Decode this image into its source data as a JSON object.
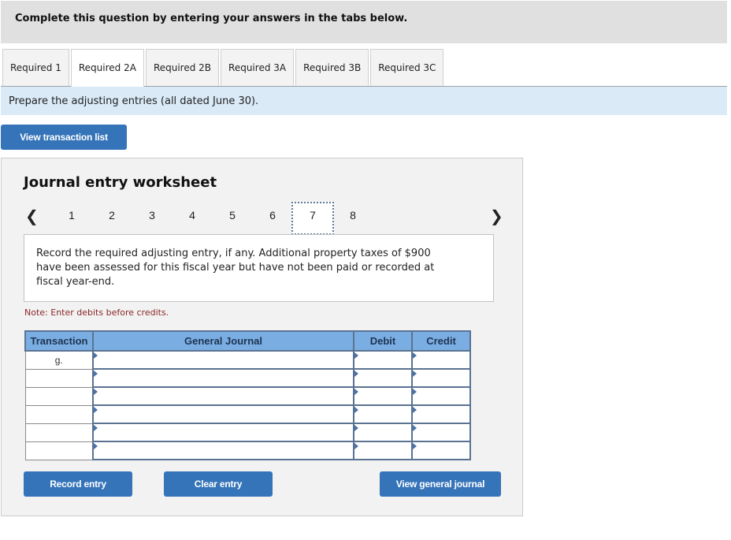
{
  "header": {
    "text": "Complete this question by entering your answers in the tabs below."
  },
  "tabs": [
    {
      "label": "Required 1",
      "active": false
    },
    {
      "label": "Required 2A",
      "active": true
    },
    {
      "label": "Required 2B",
      "active": false
    },
    {
      "label": "Required 3A",
      "active": false
    },
    {
      "label": "Required 3B",
      "active": false
    },
    {
      "label": "Required 3C",
      "active": false
    }
  ],
  "instruction": "Prepare the adjusting entries (all dated June 30).",
  "buttons": {
    "view_transaction_list": "View transaction list",
    "record_entry": "Record entry",
    "clear_entry": "Clear entry",
    "view_general_journal": "View general journal"
  },
  "worksheet": {
    "title": "Journal entry worksheet",
    "pager": {
      "prev_icon": "chevron-left-icon",
      "next_icon": "chevron-right-icon",
      "pages": [
        "1",
        "2",
        "3",
        "4",
        "5",
        "6",
        "7",
        "8"
      ],
      "current": "7"
    },
    "question": "Record the required adjusting entry, if any. Additional property taxes of $900 have been assessed for this fiscal year but have not been paid or recorded at fiscal year-end.",
    "note": "Note: Enter debits before credits.",
    "table": {
      "headers": {
        "transaction": "Transaction",
        "general_journal": "General Journal",
        "debit": "Debit",
        "credit": "Credit"
      },
      "rows": [
        {
          "transaction": "g.",
          "account": "",
          "debit": "",
          "credit": ""
        },
        {
          "transaction": "",
          "account": "",
          "debit": "",
          "credit": ""
        },
        {
          "transaction": "",
          "account": "",
          "debit": "",
          "credit": ""
        },
        {
          "transaction": "",
          "account": "",
          "debit": "",
          "credit": ""
        },
        {
          "transaction": "",
          "account": "",
          "debit": "",
          "credit": ""
        },
        {
          "transaction": "",
          "account": "",
          "debit": "",
          "credit": ""
        }
      ]
    }
  },
  "colors": {
    "button_blue": "#3574b9",
    "table_header_blue": "#7aaee3",
    "instruction_bg": "#daeaf7",
    "note_red": "#8b2727"
  }
}
